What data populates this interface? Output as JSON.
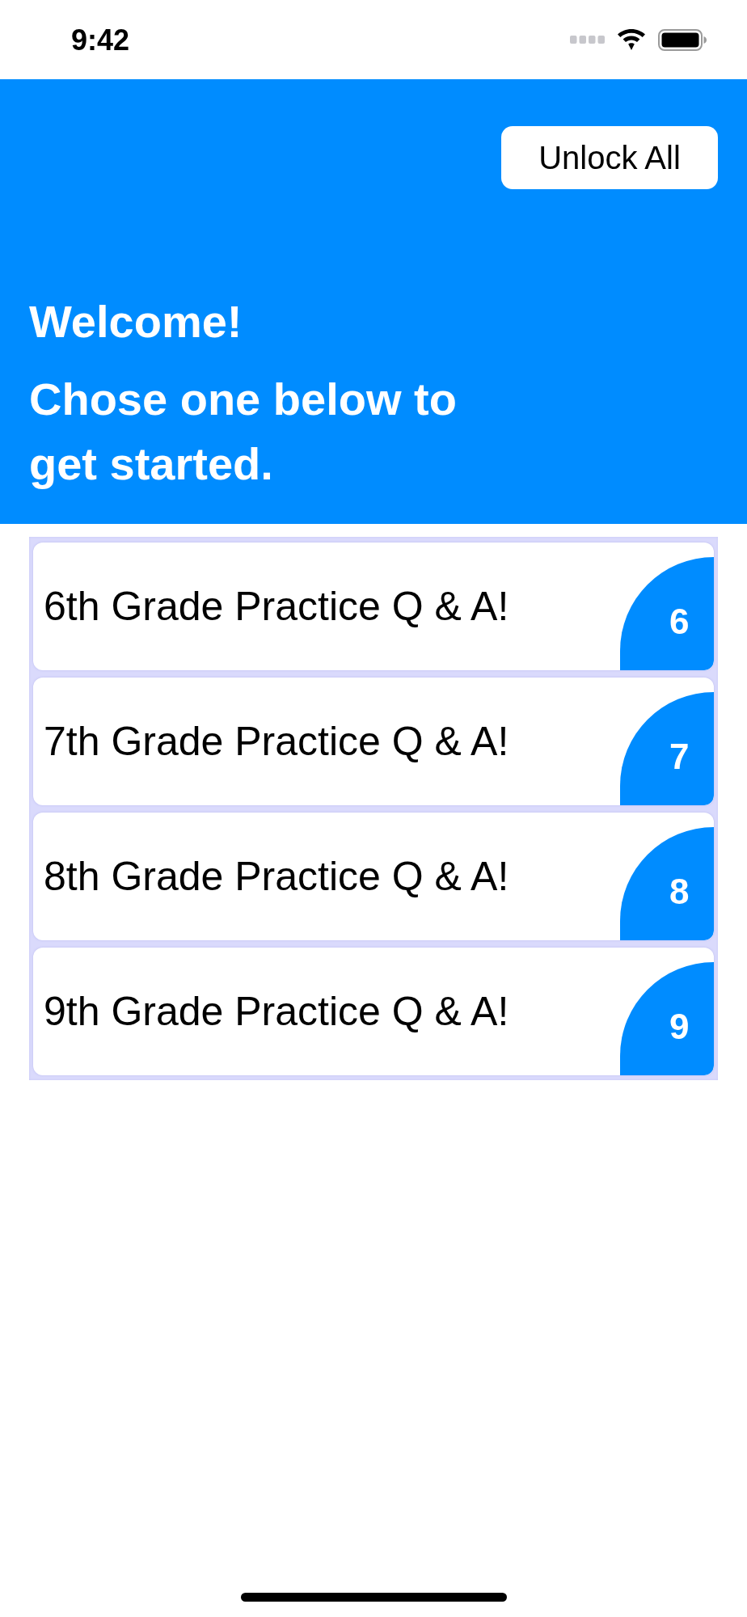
{
  "status_bar": {
    "time": "9:42"
  },
  "header": {
    "unlock_button": "Unlock All",
    "greeting": "Welcome!",
    "subtitle": "Chose one below to get started."
  },
  "grades": [
    {
      "title": "6th Grade Practice Q & A!",
      "number": "6"
    },
    {
      "title": "7th Grade Practice Q & A!",
      "number": "7"
    },
    {
      "title": "8th Grade Practice Q & A!",
      "number": "8"
    },
    {
      "title": "9th Grade Practice Q & A!",
      "number": "9"
    }
  ]
}
